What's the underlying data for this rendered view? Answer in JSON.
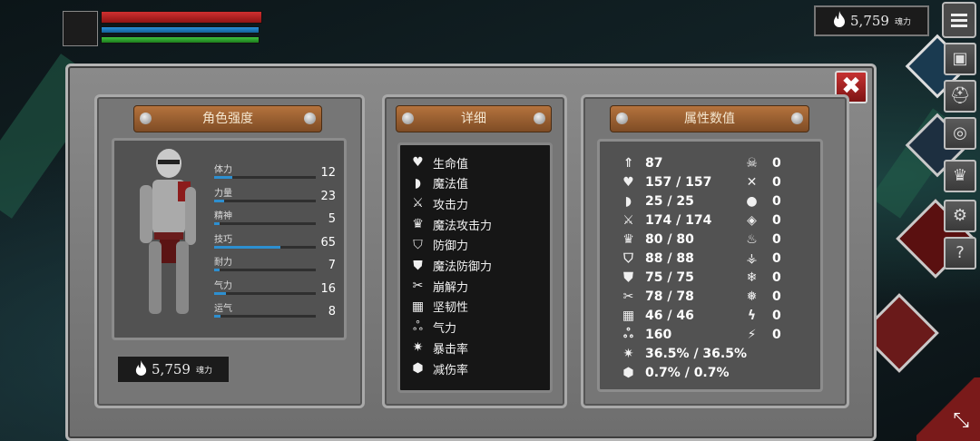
{
  "hud": {
    "soul_value": "5,759",
    "soul_unit": "魂力"
  },
  "window": {
    "close_label": "✖",
    "sections": {
      "character": "角色强度",
      "details": "详细",
      "attributes": "属性数值"
    }
  },
  "character": {
    "stats": [
      {
        "name": "体力",
        "value": "12",
        "fill": 0.18
      },
      {
        "name": "力量",
        "value": "23",
        "fill": 0.1
      },
      {
        "name": "精神",
        "value": "5",
        "fill": 0.05
      },
      {
        "name": "技巧",
        "value": "65",
        "fill": 0.65
      },
      {
        "name": "耐力",
        "value": "7",
        "fill": 0.05
      },
      {
        "name": "气力",
        "value": "16",
        "fill": 0.12
      },
      {
        "name": "运气",
        "value": "8",
        "fill": 0.06
      }
    ],
    "soul_value": "5,759",
    "soul_unit": "魂力"
  },
  "details": [
    {
      "icon": "heart-icon",
      "label": "生命值"
    },
    {
      "icon": "helmet-icon",
      "label": "魔法值"
    },
    {
      "icon": "sword-icon",
      "label": "攻击力"
    },
    {
      "icon": "crown-icon",
      "label": "魔法攻击力"
    },
    {
      "icon": "shield-icon",
      "label": "防御力"
    },
    {
      "icon": "magic-shield-icon",
      "label": "魔法防御力"
    },
    {
      "icon": "break-icon",
      "label": "崩解力"
    },
    {
      "icon": "toughness-icon",
      "label": "坚韧性"
    },
    {
      "icon": "lungs-icon",
      "label": "气力"
    },
    {
      "icon": "critical-icon",
      "label": "暴击率"
    },
    {
      "icon": "damage-reduction-icon",
      "label": "减伤率"
    }
  ],
  "attributes": {
    "main": [
      {
        "icon": "level-icon",
        "value": "87"
      },
      {
        "icon": "heart-icon",
        "value": "157 / 157"
      },
      {
        "icon": "helmet-icon",
        "value": "25 / 25"
      },
      {
        "icon": "sword-icon",
        "value": "174 / 174"
      },
      {
        "icon": "crown-icon",
        "value": "80 / 80"
      },
      {
        "icon": "shield-icon",
        "value": "88 / 88"
      },
      {
        "icon": "magic-shield-icon",
        "value": "75 / 75"
      },
      {
        "icon": "break-icon",
        "value": "78 / 78"
      },
      {
        "icon": "toughness-icon",
        "value": "46 / 46"
      },
      {
        "icon": "lungs-icon",
        "value": "160"
      },
      {
        "icon": "critical-icon",
        "value": "36.5% / 36.5%"
      },
      {
        "icon": "damage-reduction-icon",
        "value": "0.7% / 0.7%"
      }
    ],
    "resist": [
      {
        "icon": "skull-icon",
        "value": "0"
      },
      {
        "icon": "bones-icon",
        "value": "0"
      },
      {
        "icon": "poison-drop-icon",
        "value": "0"
      },
      {
        "icon": "bleed-icon",
        "value": "0"
      },
      {
        "icon": "fire-icon",
        "value": "0"
      },
      {
        "icon": "fire-resist-icon",
        "value": "0"
      },
      {
        "icon": "frost-icon",
        "value": "0"
      },
      {
        "icon": "frost-resist-icon",
        "value": "0"
      },
      {
        "icon": "lightning-icon",
        "value": "0"
      },
      {
        "icon": "lightning-resist-icon",
        "value": "0"
      }
    ]
  },
  "sidebar": {
    "buttons": [
      {
        "icon": "armor-icon"
      },
      {
        "icon": "helmet-icon"
      },
      {
        "icon": "gear-ring-icon"
      },
      {
        "icon": "crown-icon"
      },
      {
        "icon": "settings-icon"
      },
      {
        "icon": "help-icon",
        "label": "?"
      }
    ]
  }
}
